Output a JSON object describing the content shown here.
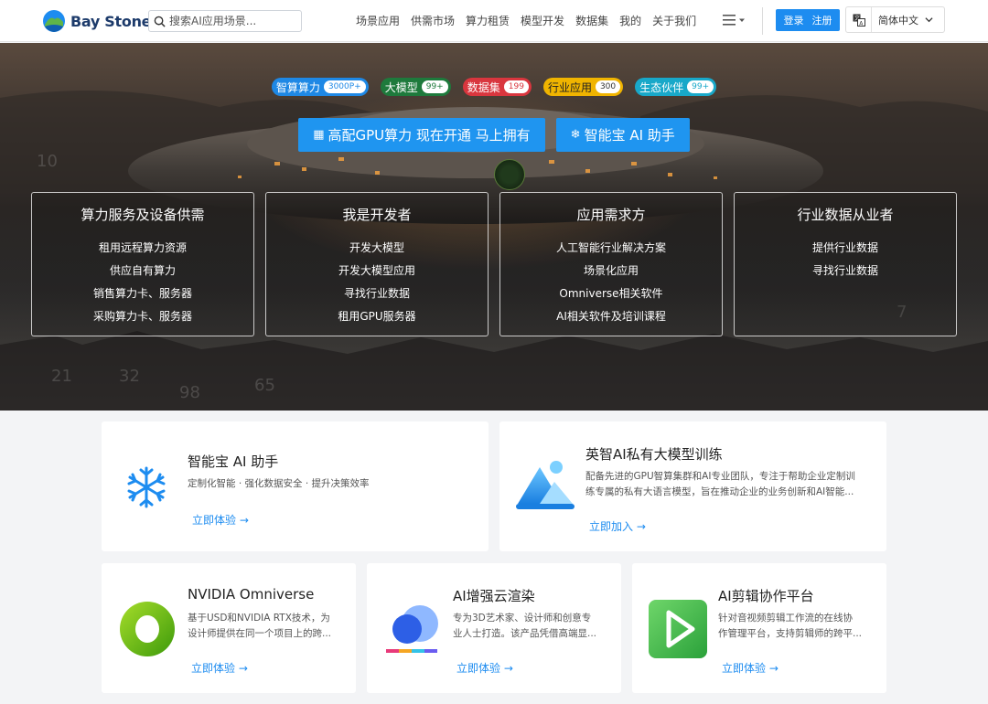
{
  "header": {
    "logo_text": "Bay Stone",
    "search_placeholder": "搜索AI应用场景...",
    "nav": [
      "场景应用",
      "供需市场",
      "算力租赁",
      "模型开发",
      "数据集",
      "我的",
      "关于我们"
    ],
    "login": "登录",
    "register": "注册",
    "language": "简体中文"
  },
  "hero": {
    "badges": [
      {
        "label": "智算算力",
        "count": "3000P+",
        "color": "#1e88e5",
        "count_color": "#1e88e5"
      },
      {
        "label": "大模型",
        "count": "99+",
        "color": "#1e7a3c",
        "count_color": "#1e7a3c"
      },
      {
        "label": "数据集",
        "count": "199",
        "color": "#d9363e",
        "count_color": "#d9363e"
      },
      {
        "label": "行业应用",
        "count": "300",
        "color": "#f0b400",
        "count_color": "#333333"
      },
      {
        "label": "生态伙伴",
        "count": "99+",
        "color": "#18a8c9",
        "count_color": "#18a8c9"
      }
    ],
    "cta": [
      {
        "icon": "server-icon",
        "label": "高配GPU算力 现在开通 马上拥有"
      },
      {
        "icon": "snowflake-icon",
        "label": "智能宝 AI 助手"
      }
    ],
    "panels": [
      {
        "title": "算力服务及设备供需",
        "items": [
          "租用远程算力资源",
          "供应自有算力",
          "销售算力卡、服务器",
          "采购算力卡、服务器"
        ]
      },
      {
        "title": "我是开发者",
        "items": [
          "开发大模型",
          "开发大模型应用",
          "寻找行业数据",
          "租用GPU服务器"
        ]
      },
      {
        "title": "应用需求方",
        "items": [
          "人工智能行业解决方案",
          "场景化应用",
          "Omniverse相关软件",
          "AI相关软件及培训课程"
        ]
      },
      {
        "title": "行业数据从业者",
        "items": [
          "提供行业数据",
          "寻找行业数据"
        ]
      }
    ]
  },
  "cards": {
    "assistant": {
      "title": "智能宝 AI 助手",
      "desc": "定制化智能 · 强化数据安全 · 提升决策效率",
      "link": "立即体验 →"
    },
    "training": {
      "title": "英智AI私有大模型训练",
      "desc1": "配备先进的GPU智算集群和AI专业团队，专注于帮助企业定制训",
      "desc2": "练专属的私有大语言模型，旨在推动企业的业务创新和AI智能...",
      "link": "立即加入 →"
    },
    "omniverse": {
      "title": "NVIDIA Omniverse",
      "desc1": "基于USD和NVIDIA RTX技术，为",
      "desc2": "设计师提供在同一个项目上的跨...",
      "link": "立即体验 →"
    },
    "render": {
      "title": "AI增强云渲染",
      "desc1": "专为3D艺术家、设计师和创意专",
      "desc2": "业人士打造。该产品凭借高端显...",
      "link": "立即体验 →"
    },
    "edit": {
      "title": "AI剪辑协作平台",
      "desc1": "针对音视频剪辑工作流的在线协",
      "desc2": "作管理平台，支持剪辑师的跨平...",
      "link": "立即体验 →"
    }
  }
}
